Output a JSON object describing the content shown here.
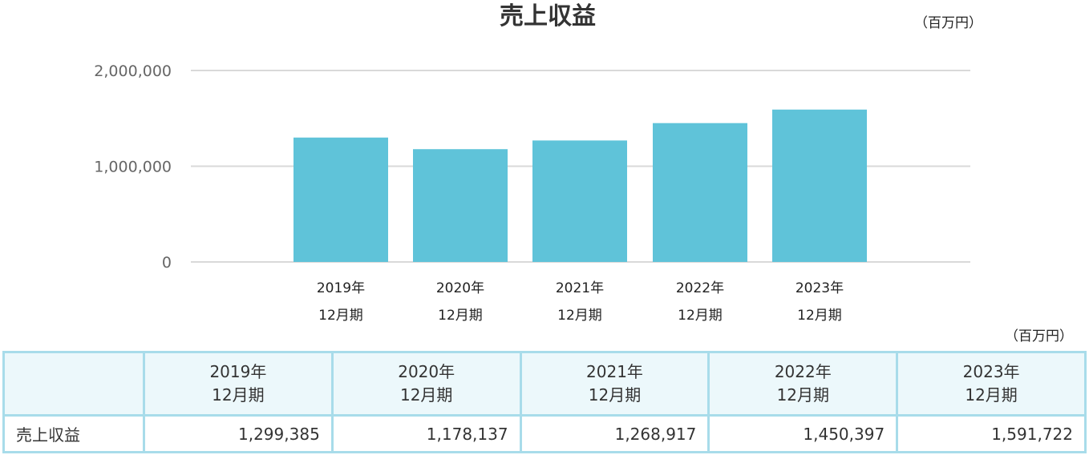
{
  "chart_data": {
    "type": "bar",
    "title": "売上収益",
    "unit": "（百万円）",
    "categories": [
      [
        "2019年",
        "12月期"
      ],
      [
        "2020年",
        "12月期"
      ],
      [
        "2021年",
        "12月期"
      ],
      [
        "2022年",
        "12月期"
      ],
      [
        "2023年",
        "12月期"
      ]
    ],
    "series": [
      {
        "values": [
          1299385,
          1178137,
          1268917,
          1450397,
          1591722
        ]
      }
    ],
    "yticks": [
      "0",
      "1,000,000",
      "2,000,000"
    ],
    "ylim": [
      0,
      2000000
    ],
    "grid": true,
    "bar_color": "#5fc3d9"
  },
  "table": {
    "unit": "（百万円）",
    "header_line1": [
      "2019年",
      "2020年",
      "2021年",
      "2022年",
      "2023年"
    ],
    "header_line2": [
      "12月期",
      "12月期",
      "12月期",
      "12月期",
      "12月期"
    ],
    "row_label": "売上収益",
    "row_values": [
      "1,299,385",
      "1,178,137",
      "1,268,917",
      "1,450,397",
      "1,591,722"
    ]
  }
}
